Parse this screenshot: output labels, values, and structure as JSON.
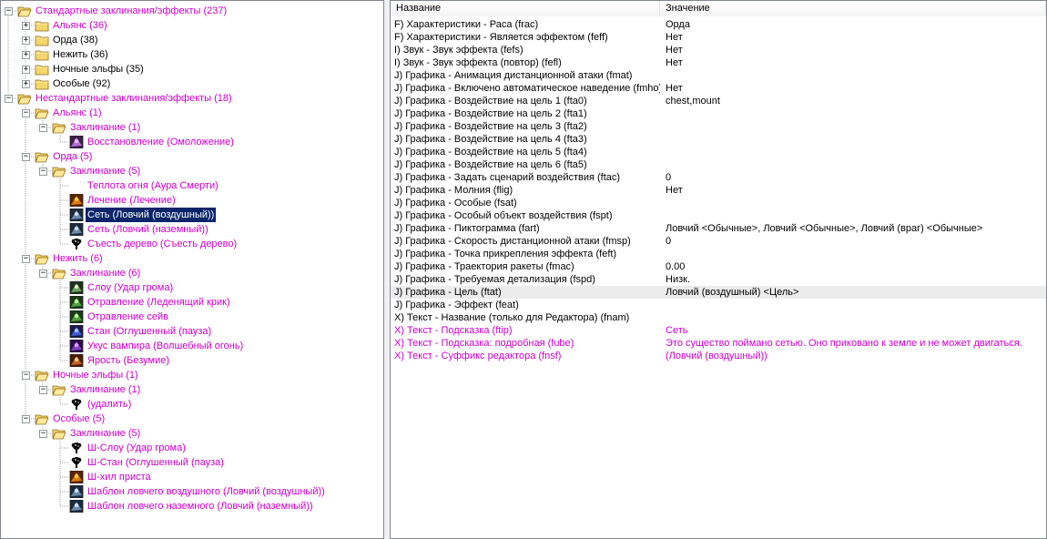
{
  "colors": {
    "accent_magenta": "#cc00cc",
    "selection": "#0a246a",
    "folder_yellow": "#f6d66a"
  },
  "tree": [
    {
      "depth": 0,
      "expander": "minus",
      "icon": "folder-open",
      "label": "Стандартные заклинания/эффекты (237)",
      "magenta": true
    },
    {
      "depth": 1,
      "expander": "plus",
      "icon": "folder",
      "label": "Альянс (36)",
      "magenta": true
    },
    {
      "depth": 1,
      "expander": "plus",
      "icon": "folder",
      "label": "Орда (38)",
      "magenta": false
    },
    {
      "depth": 1,
      "expander": "plus",
      "icon": "folder",
      "label": "Нежить (36)",
      "magenta": false
    },
    {
      "depth": 1,
      "expander": "plus",
      "icon": "folder",
      "label": "Ночные эльфы (35)",
      "magenta": false
    },
    {
      "depth": 1,
      "expander": "plus",
      "icon": "folder",
      "label": "Особые (92)",
      "magenta": false
    },
    {
      "depth": 0,
      "expander": "minus",
      "icon": "folder-open",
      "label": "Нестандартные заклинания/эффекты (18)",
      "magenta": true
    },
    {
      "depth": 1,
      "expander": "minus",
      "icon": "folder-open",
      "label": "Альянс (1)",
      "magenta": true
    },
    {
      "depth": 2,
      "expander": "minus",
      "icon": "folder-open",
      "label": "Заклинание (1)",
      "magenta": true
    },
    {
      "depth": 3,
      "expander": "none",
      "icon": "spell-heal",
      "label": "Восстановление (Омоложение)",
      "magenta": true
    },
    {
      "depth": 1,
      "expander": "minus",
      "icon": "folder-open",
      "label": "Орда (5)",
      "magenta": true
    },
    {
      "depth": 2,
      "expander": "minus",
      "icon": "folder-open",
      "label": "Заклинание (5)",
      "magenta": true
    },
    {
      "depth": 3,
      "expander": "none",
      "icon": "none",
      "label": "Теплота огня (Аура Смерти)",
      "magenta": true
    },
    {
      "depth": 3,
      "expander": "none",
      "icon": "spell-fire",
      "label": "Лечение (Лечение)",
      "magenta": true
    },
    {
      "depth": 3,
      "expander": "none",
      "icon": "spell-net",
      "label": "Сеть (Ловчий (воздушный))",
      "magenta": false,
      "selected": true
    },
    {
      "depth": 3,
      "expander": "none",
      "icon": "spell-net",
      "label": "Сеть (Ловчий (наземный))",
      "magenta": true
    },
    {
      "depth": 3,
      "expander": "none",
      "icon": "spell-tree",
      "label": "Съесть дерево (Съесть дерево)",
      "magenta": true
    },
    {
      "depth": 1,
      "expander": "minus",
      "icon": "folder-open",
      "label": "Нежить (6)",
      "magenta": true
    },
    {
      "depth": 2,
      "expander": "minus",
      "icon": "folder-open",
      "label": "Заклинание (6)",
      "magenta": true
    },
    {
      "depth": 3,
      "expander": "none",
      "icon": "spell-thunder",
      "label": "Слоу (Удар грома)",
      "magenta": true
    },
    {
      "depth": 3,
      "expander": "none",
      "icon": "spell-poison",
      "label": "Отравление (Леденящий крик)",
      "magenta": true
    },
    {
      "depth": 3,
      "expander": "none",
      "icon": "spell-poison",
      "label": "Отравление сейв",
      "magenta": true
    },
    {
      "depth": 3,
      "expander": "none",
      "icon": "spell-stun",
      "label": "Стан (Оглушенный (пауза)",
      "magenta": true
    },
    {
      "depth": 3,
      "expander": "none",
      "icon": "spell-vampire",
      "label": "Укус вампира (Волшебный огонь)",
      "magenta": true
    },
    {
      "depth": 3,
      "expander": "none",
      "icon": "spell-rage",
      "label": "Ярость (Безумие)",
      "magenta": true
    },
    {
      "depth": 1,
      "expander": "minus",
      "icon": "folder-open",
      "label": "Ночные эльфы (1)",
      "magenta": true
    },
    {
      "depth": 2,
      "expander": "minus",
      "icon": "folder-open",
      "label": "Заклинание (1)",
      "magenta": true
    },
    {
      "depth": 3,
      "expander": "none",
      "icon": "spell-tree",
      "label": "(удалить)",
      "magenta": true
    },
    {
      "depth": 1,
      "expander": "minus",
      "icon": "folder-open",
      "label": "Особые (5)",
      "magenta": true
    },
    {
      "depth": 2,
      "expander": "minus",
      "icon": "folder-open",
      "label": "Заклинание (5)",
      "magenta": true
    },
    {
      "depth": 3,
      "expander": "none",
      "icon": "spell-tree",
      "label": "Ш-Слоу (Удар грома)",
      "magenta": true
    },
    {
      "depth": 3,
      "expander": "none",
      "icon": "spell-tree",
      "label": "Ш-Стан (Оглушенный (пауза)",
      "magenta": true
    },
    {
      "depth": 3,
      "expander": "none",
      "icon": "spell-fire",
      "label": "Ш-хил приста",
      "magenta": true
    },
    {
      "depth": 3,
      "expander": "none",
      "icon": "spell-net",
      "label": "Шаблон ловчего воздушного (Ловчий (воздушный))",
      "magenta": true
    },
    {
      "depth": 3,
      "expander": "none",
      "icon": "spell-net",
      "label": "Шаблон ловчего наземного (Ловчий (наземный))",
      "magenta": true
    }
  ],
  "properties": {
    "header_name": "Название",
    "header_value": "Значение",
    "rows": [
      {
        "name": "F) Характеристики - Раса (frac)",
        "value": "Орда"
      },
      {
        "name": "F) Характеристики - Является эффектом (feff)",
        "value": "Нет"
      },
      {
        "name": "I) Звук - Звук эффекта (fefs)",
        "value": "Нет"
      },
      {
        "name": "I) Звук - Звук эффекта (повтор) (fefl)",
        "value": "Нет"
      },
      {
        "name": "J) Графика - Анимация дистанционной атаки (fmat)",
        "value": ""
      },
      {
        "name": "J) Графика - Включено автоматическое наведение (fmho)",
        "value": "Нет"
      },
      {
        "name": "J) Графика - Воздействие на цель 1 (fta0)",
        "value": "chest,mount"
      },
      {
        "name": "J) Графика - Воздействие на цель 2 (fta1)",
        "value": ""
      },
      {
        "name": "J) Графика - Воздействие на цель 3 (fta2)",
        "value": ""
      },
      {
        "name": "J) Графика - Воздействие на цель 4 (fta3)",
        "value": ""
      },
      {
        "name": "J) Графика - Воздействие на цель 5 (fta4)",
        "value": ""
      },
      {
        "name": "J) Графика - Воздействие на цель 6 (fta5)",
        "value": ""
      },
      {
        "name": "J) Графика - Задать сценарий воздействия (ftac)",
        "value": "0"
      },
      {
        "name": "J) Графика - Молния (flig)",
        "value": "Нет"
      },
      {
        "name": "J) Графика - Особые (fsat)",
        "value": ""
      },
      {
        "name": "J) Графика - Особый объект воздействия (fspt)",
        "value": ""
      },
      {
        "name": "J) Графика - Пиктограмма (fart)",
        "value": "Ловчий <Обычные>, Ловчий <Обычные>, Ловчий (враг) <Обычные>"
      },
      {
        "name": "J) Графика - Скорость дистанционной атаки (fmsp)",
        "value": "0"
      },
      {
        "name": "J) Графика - Точка прикрепления эффекта (feft)",
        "value": ""
      },
      {
        "name": "J) Графика - Траектория ракеты (fmac)",
        "value": "0.00"
      },
      {
        "name": "J) Графика - Требуемая детализация (fspd)",
        "value": "Низк."
      },
      {
        "name": "J) Графика - Цель (ftat)",
        "value": "Ловчий (воздушный) <Цель>",
        "highlight": true
      },
      {
        "name": "J) Графика - Эффект (feat)",
        "value": ""
      },
      {
        "name": "X) Текст - Название (только для Редактора) (fnam)",
        "value": ""
      },
      {
        "name": "X) Текст - Подсказка (ftip)",
        "value": "Сеть",
        "magenta": true
      },
      {
        "name": "X) Текст - Подсказка: подробная (fube)",
        "value": "Это существо поймано сетью. Оно приковано к земле и не может двигаться.",
        "magenta": true
      },
      {
        "name": "X) Текст - Суффикс редактора (fnsf)",
        "value": "(Ловчий (воздушный))",
        "magenta": true
      }
    ]
  }
}
